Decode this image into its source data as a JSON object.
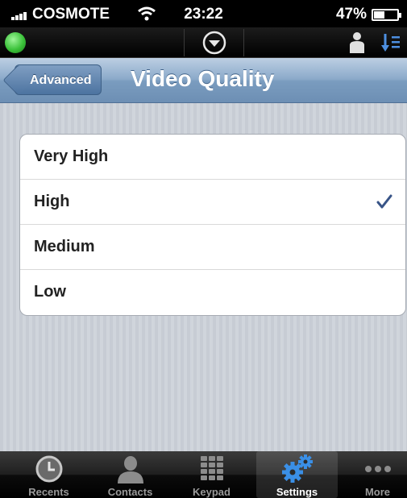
{
  "status_bar": {
    "carrier": "COSMOTE",
    "time": "23:22",
    "battery_percent": "47%",
    "battery_level": 0.47,
    "signal_icon": "signal-bars-icon",
    "wifi_icon": "wifi-icon"
  },
  "app_toolbar": {
    "presence_status_color": "#3bc23a",
    "dropdown_icon": "chevron-down-circle-icon",
    "contact_icon": "person-icon",
    "sort_icon": "sort-list-icon"
  },
  "nav_bar": {
    "back_label": "Advanced",
    "title": "Video Quality"
  },
  "video_quality": {
    "options": [
      {
        "label": "Very High",
        "selected": false
      },
      {
        "label": "High",
        "selected": true
      },
      {
        "label": "Medium",
        "selected": false
      },
      {
        "label": "Low",
        "selected": false
      }
    ],
    "check_color": "#385487"
  },
  "tab_bar": {
    "selected": "Settings",
    "tabs": [
      {
        "label": "Recents",
        "icon": "clock-icon"
      },
      {
        "label": "Contacts",
        "icon": "person-icon"
      },
      {
        "label": "Keypad",
        "icon": "keypad-icon"
      },
      {
        "label": "Settings",
        "icon": "gears-icon"
      },
      {
        "label": "More",
        "icon": "more-dots-icon"
      }
    ]
  }
}
